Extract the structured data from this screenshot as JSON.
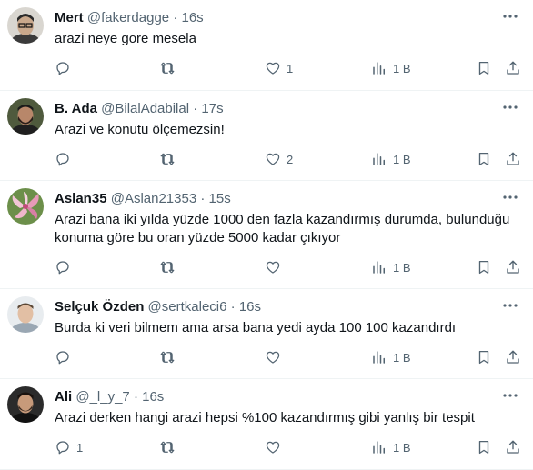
{
  "tweets": [
    {
      "name": "Mert",
      "handle": "@fakerdagge",
      "sep": "·",
      "time": "16s",
      "text": "arazi neye gore mesela",
      "replies": "",
      "likes": "1",
      "views": "1 B",
      "avatar": "man-glasses"
    },
    {
      "name": "B. Ada",
      "handle": "@BilalAdabilal",
      "sep": "·",
      "time": "17s",
      "text": "Arazi ve konutu ölçemezsin!",
      "replies": "",
      "likes": "2",
      "views": "1 B",
      "avatar": "man-beard"
    },
    {
      "name": "Aslan35",
      "handle": "@Aslan21353",
      "sep": "·",
      "time": "15s",
      "text": "Arazi bana iki yılda yüzde 1000 den fazla kazandırmış durumda, bulunduğu konuma göre bu oran yüzde 5000 kadar çıkıyor",
      "replies": "",
      "likes": "",
      "views": "1 B",
      "avatar": "pink-lily"
    },
    {
      "name": "Selçuk Özden",
      "handle": "@sertkaleci6",
      "sep": "·",
      "time": "16s",
      "text": "Burda ki veri bilmem ama arsa bana yedi ayda 100 100 kazandırdı",
      "replies": "",
      "likes": "",
      "views": "1 B",
      "avatar": "man-light"
    },
    {
      "name": "Ali",
      "handle": "@_l_y_7",
      "sep": "·",
      "time": "16s",
      "text": "Arazi derken hangi arazi hepsi %100 kazandırmış gibi yanlış bir tespit",
      "replies": "1",
      "likes": "",
      "views": "1 B",
      "avatar": "man-dark"
    }
  ],
  "icons": {
    "more": "more-icon",
    "reply": "reply-icon",
    "retweet": "retweet-icon",
    "like": "like-icon",
    "views": "views-icon",
    "bookmark": "bookmark-icon",
    "share": "share-icon"
  },
  "colors": {
    "text": "#0f1419",
    "secondary": "#536471",
    "border": "#eff3f4"
  }
}
